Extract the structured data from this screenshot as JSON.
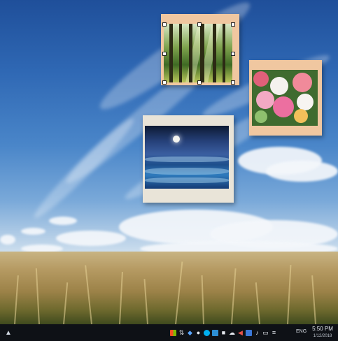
{
  "desktop": {
    "widgets": [
      {
        "name": "photo-widget-forest",
        "frame_color": "#f0c7a0"
      },
      {
        "name": "photo-widget-flowers",
        "frame_color": "#f0c7a0"
      },
      {
        "name": "photo-widget-sea",
        "frame_color": "#e9e4d8"
      }
    ]
  },
  "taskbar": {
    "start_icon": "show-hidden-icons-icon",
    "tray_icons": [
      "windows-logo-icon",
      "network-icon",
      "dropbox-icon",
      "chat-icon",
      "skype-icon",
      "screen-icon",
      "app-icon",
      "cloud-icon",
      "sync-icon",
      "folder-icon",
      "volume-icon",
      "notification-icon",
      "wifi-icon"
    ],
    "language": "ENG",
    "time": "5:50 PM",
    "date": "1/12/2018"
  }
}
